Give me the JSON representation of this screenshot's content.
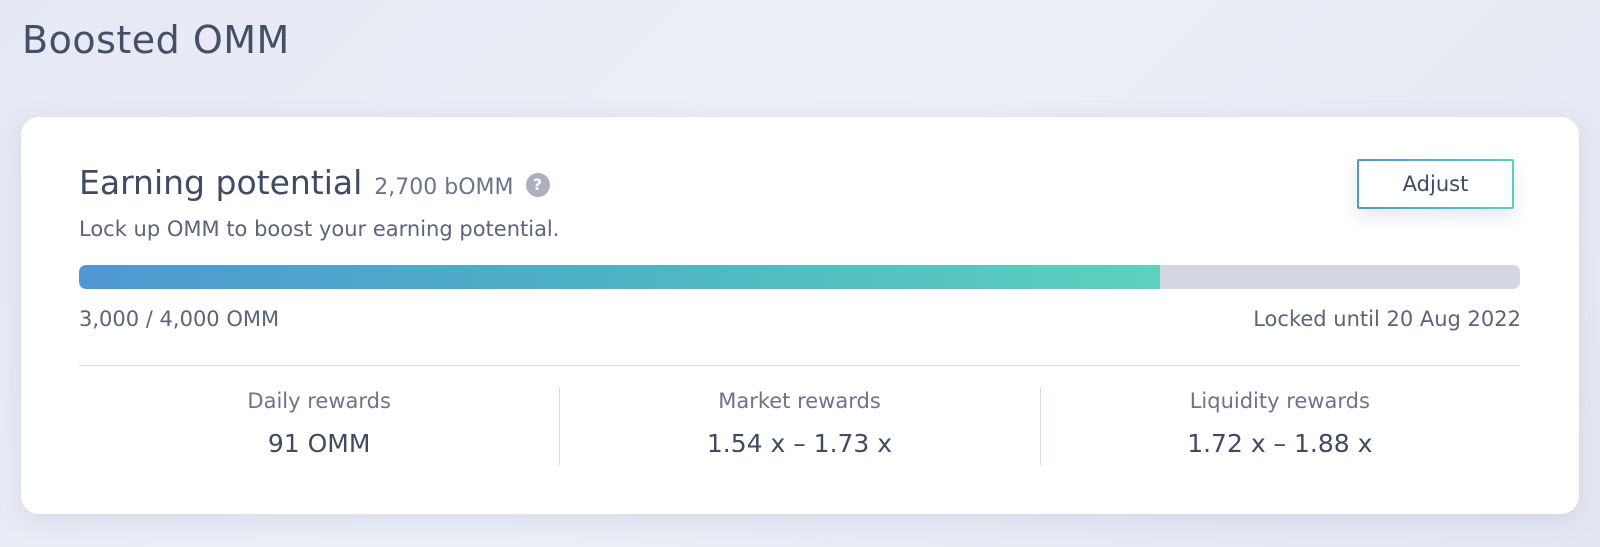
{
  "page": {
    "title": "Boosted OMM"
  },
  "card": {
    "heading": "Earning potential",
    "bomm_amount": "2,700 bOMM",
    "help_icon": "question-circle-icon",
    "subtitle": "Lock up OMM to boost your earning potential.",
    "adjust_label": "Adjust",
    "progress": {
      "locked": 3000,
      "total": 4000,
      "fraction": 0.75
    },
    "locked_amount": "3,000 / 4,000 OMM",
    "locked_until": "Locked until 20 Aug 2022"
  },
  "stats": [
    {
      "label": "Daily rewards",
      "value": "91 OMM"
    },
    {
      "label": "Market rewards",
      "value": "1.54 x – 1.73 x"
    },
    {
      "label": "Liquidity rewards",
      "value": "1.72 x – 1.88 x"
    }
  ],
  "colors": {
    "background": "#e8ebf5",
    "card": "#ffffff",
    "text_primary": "#3f4a63",
    "text_secondary": "#5b6478",
    "accent_start": "#4f97d2",
    "accent_end": "#5cd2be",
    "track": "#d3d7e2"
  }
}
